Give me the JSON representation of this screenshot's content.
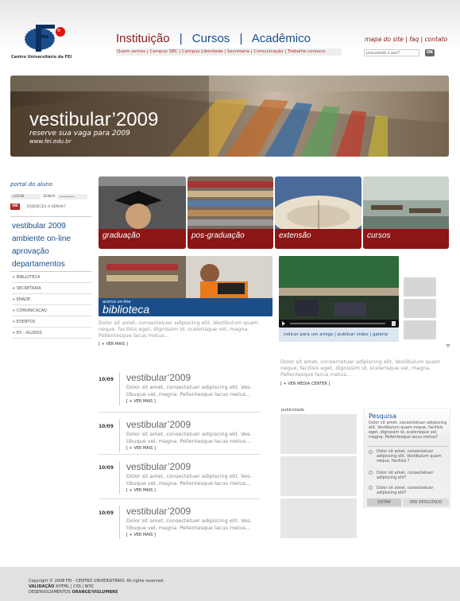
{
  "header": {
    "logo_text": "Centro Universitário da FEI",
    "nav": [
      "Instituição",
      "Cursos",
      "Acadêmico"
    ],
    "nav_sep": "|",
    "utility": {
      "sitemap": "mapa do site",
      "faq": "faq",
      "contact": "contato",
      "sep": "|"
    },
    "subnav": [
      "Quem somos",
      "Campus SBC",
      "Campus Liberdade",
      "Secretaria",
      "Comunicação",
      "Trabalhe conosco"
    ],
    "search_placeholder": "procurando o que?",
    "search_button": "OK"
  },
  "banner": {
    "title": "vestibular’2009",
    "subtitle": "reserve sua vaga para 2009",
    "url": "www.fei.edu.br"
  },
  "sidebar": {
    "portal_title": "portal do aluno",
    "login_label": "LOGIN",
    "senha_label": "SENHA",
    "senha_value": "••••••••",
    "ok": "OK",
    "forgot": "ESQUECEU A SENHA?",
    "main_links": [
      "vestibular 2009",
      "ambiente on-line",
      "aprovação",
      "departamentos"
    ],
    "sub_links": [
      "+ BIBLIOTECA",
      "+ SECRETARIA",
      "+ ENADE",
      "+ COMUNICAÇÃO",
      "+ EVENTOS",
      "+ EX - ALUNOS"
    ]
  },
  "categories": [
    "graduação",
    "pos-graduação",
    "extensão",
    "cursos"
  ],
  "library": {
    "kicker": "acervo on-line",
    "title": "biblioteca",
    "text": "Dolor sit amet, consectetuer adipiscing elit. Vestibulum quam neque, facilisis eget, dignissim id, scelerisque vel, magna. Pellentesque lacus metus...",
    "more": "[ + VER MAIS ]"
  },
  "video": {
    "links": [
      "indicar para um amigo",
      "publicar vídeo",
      "galeria"
    ],
    "link_sep": "|",
    "text": "Dolor sit amet, consectetuer adipiscing elit. Vestibulum quam neque, facilisis eget, dignissim id, scelerisque vel, magna. Pellentesque lacus metus...",
    "more": "[ + VER MEDIA CENTER ]"
  },
  "news": [
    {
      "date": "10/09",
      "title": "vestibular’2009",
      "text": "Dolor sit amet, consectetuer adipiscing elit. Ves-tibuque vel, magna. Pellentesque lacus metus...",
      "more": "[ + VER MAIS ]"
    },
    {
      "date": "10/09",
      "title": "vestibular’2009",
      "text": "Dolor sit amet, consectetuer adipiscing elit. Ves-tibuque vel, magna. Pellentesque lacus metus...",
      "more": "[ + VER MAIS ]"
    },
    {
      "date": "10/09",
      "title": "vestibular’2009",
      "text": "Dolor sit amet, consectetuer adipiscing elit. Ves-tibuque vel, magna. Pellentesque lacus metus...",
      "more": "[ + VER MAIS ]"
    },
    {
      "date": "10/09",
      "title": "vestibular’2009",
      "text": "Dolor sit amet, consectetuer adipiscing elit. Ves-tibuque vel, magna. Pellentesque lacus metus...",
      "more": "[ + VER MAIS ]"
    }
  ],
  "ads": {
    "label": "publicidade"
  },
  "poll": {
    "title": "Pesquisa",
    "question": "Dolor sit amet, consectetuer adipiscing elit. Vestibulum quam neque, facilisis eget, dignissim id, scelerisque vel, magna. Pellentesque lacus metus?",
    "options": [
      "Dolor sit amet, consectetuer adipiscing elit. Vestibulum quam neque, facilisis ?",
      "Dolor sit amet, consectetuer adipiscing elit?",
      "Dolor sit amet, consectetuer adipiscing elit?"
    ],
    "vote": "VOTAR",
    "results": "VER RESULTADO"
  },
  "footer": {
    "copyright": "Copyright © 2008 FEI - CENTRO UNIVERSITÁRIO. All rights reserved.",
    "validation_label": "VALIDAÇÃO",
    "validation": [
      "XHTML",
      "CSS",
      "W3C"
    ],
    "validation_sep": "|",
    "dev_label": "DESENVOLVIMENTOS",
    "dev_value": "ORANGE/VISLUMBRE"
  },
  "colors": {
    "brand_red": "#8b1a1a",
    "brand_blue": "#1a4e8a",
    "band_red": "#8a1616"
  }
}
